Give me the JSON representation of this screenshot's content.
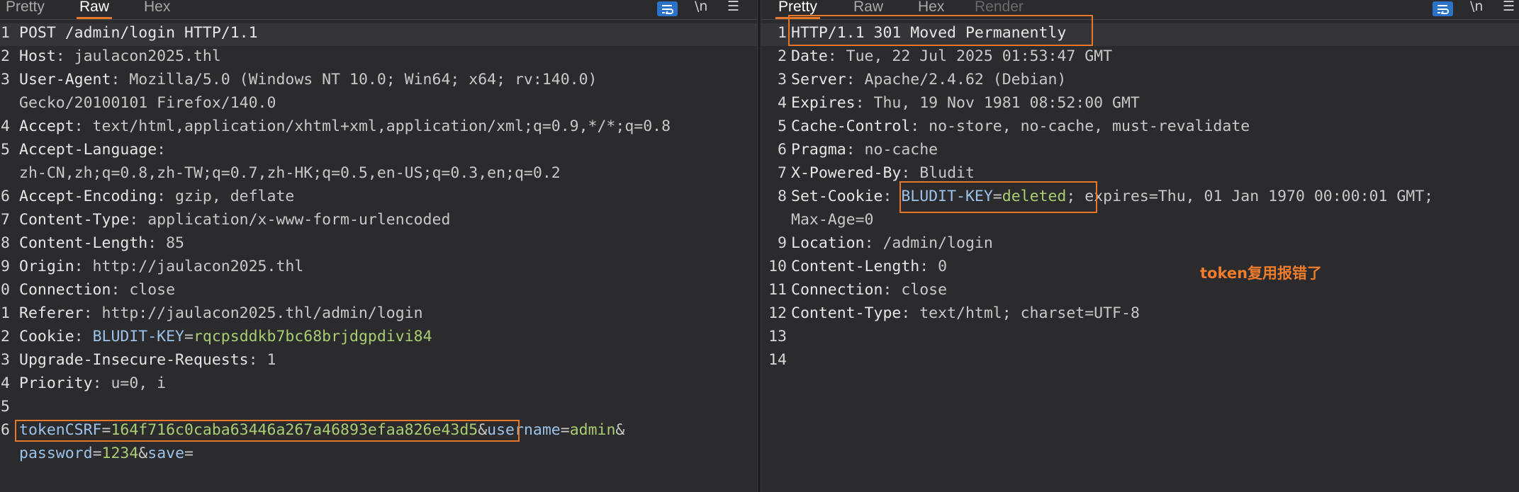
{
  "request": {
    "tabs": [
      {
        "label": "Pretty",
        "active": false
      },
      {
        "label": "Raw",
        "active": true
      },
      {
        "label": "Hex",
        "active": false
      }
    ],
    "tools": {
      "wrap_icon": "wrap-lines-icon",
      "newline_label": "\\n",
      "menu_icon": "hamburger-menu-icon"
    },
    "lines": [
      {
        "n": "1",
        "parts": [
          {
            "t": "POST /admin/login HTTP/1.1",
            "c": "k"
          }
        ]
      },
      {
        "n": "2",
        "parts": [
          {
            "t": "Host",
            "c": "k"
          },
          {
            "t": ": jaulacon2025.thl",
            "c": "v"
          }
        ]
      },
      {
        "n": "3",
        "parts": [
          {
            "t": "User-Agent",
            "c": "k"
          },
          {
            "t": ": Mozilla/5.0 (Windows NT 10.0; Win64; x64; rv:140.0)",
            "c": "v"
          }
        ]
      },
      {
        "n": "",
        "parts": [
          {
            "t": "Gecko/20100101 Firefox/140.0",
            "c": "v"
          }
        ]
      },
      {
        "n": "4",
        "parts": [
          {
            "t": "Accept",
            "c": "k"
          },
          {
            "t": ": text/html,application/xhtml+xml,application/xml;q=0.9,*/*;q=0.8",
            "c": "v"
          }
        ]
      },
      {
        "n": "5",
        "parts": [
          {
            "t": "Accept-Language",
            "c": "k"
          },
          {
            "t": ":",
            "c": "v"
          }
        ]
      },
      {
        "n": "",
        "parts": [
          {
            "t": "zh-CN,zh;q=0.8,zh-TW;q=0.7,zh-HK;q=0.5,en-US;q=0.3,en;q=0.2",
            "c": "v"
          }
        ]
      },
      {
        "n": "6",
        "parts": [
          {
            "t": "Accept-Encoding",
            "c": "k"
          },
          {
            "t": ": gzip, deflate",
            "c": "v"
          }
        ]
      },
      {
        "n": "7",
        "parts": [
          {
            "t": "Content-Type",
            "c": "k"
          },
          {
            "t": ": application/x-www-form-urlencoded",
            "c": "v"
          }
        ]
      },
      {
        "n": "8",
        "parts": [
          {
            "t": "Content-Length",
            "c": "k"
          },
          {
            "t": ": 85",
            "c": "v"
          }
        ]
      },
      {
        "n": "9",
        "parts": [
          {
            "t": "Origin",
            "c": "k"
          },
          {
            "t": ": http://jaulacon2025.thl",
            "c": "v"
          }
        ]
      },
      {
        "n": "0",
        "parts": [
          {
            "t": "Connection",
            "c": "k"
          },
          {
            "t": ": close",
            "c": "v"
          }
        ]
      },
      {
        "n": "1",
        "parts": [
          {
            "t": "Referer",
            "c": "k"
          },
          {
            "t": ": http://jaulacon2025.thl/admin/login",
            "c": "v"
          }
        ]
      },
      {
        "n": "2",
        "parts": [
          {
            "t": "Cookie",
            "c": "k"
          },
          {
            "t": ": ",
            "c": "v"
          },
          {
            "t": "BLUDIT-KEY",
            "c": "ck"
          },
          {
            "t": "=",
            "c": "v"
          },
          {
            "t": "rqcpsddkb7bc68brjdgpdivi84",
            "c": "cv"
          }
        ]
      },
      {
        "n": "3",
        "parts": [
          {
            "t": "Upgrade-Insecure-Requests",
            "c": "k"
          },
          {
            "t": ": 1",
            "c": "v"
          }
        ]
      },
      {
        "n": "4",
        "parts": [
          {
            "t": "Priority",
            "c": "k"
          },
          {
            "t": ": u=0, i",
            "c": "v"
          }
        ]
      },
      {
        "n": "5",
        "parts": []
      },
      {
        "n": "6",
        "parts": [
          {
            "t": "tokenCSRF",
            "c": "pk"
          },
          {
            "t": "=",
            "c": "v"
          },
          {
            "t": "164f716c0caba63446a267a46893efaa826e43d5",
            "c": "pv"
          },
          {
            "t": "&",
            "c": "v"
          },
          {
            "t": "username",
            "c": "pk"
          },
          {
            "t": "=",
            "c": "v"
          },
          {
            "t": "admin",
            "c": "pv"
          },
          {
            "t": "&",
            "c": "v"
          }
        ]
      },
      {
        "n": "",
        "parts": [
          {
            "t": "password",
            "c": "pk"
          },
          {
            "t": "=",
            "c": "v"
          },
          {
            "t": "1234",
            "c": "pv"
          },
          {
            "t": "&",
            "c": "v"
          },
          {
            "t": "save",
            "c": "pk"
          },
          {
            "t": "=",
            "c": "v"
          }
        ]
      }
    ]
  },
  "response": {
    "tabs": [
      {
        "label": "Pretty",
        "active": true
      },
      {
        "label": "Raw",
        "active": false
      },
      {
        "label": "Hex",
        "active": false
      },
      {
        "label": "Render",
        "active": false,
        "disabled": true
      }
    ],
    "tools": {
      "wrap_icon": "wrap-lines-icon",
      "newline_label": "\\n",
      "menu_icon": "hamburger-menu-icon"
    },
    "lines": [
      {
        "n": "1",
        "parts": [
          {
            "t": "HTTP/1.1 301 Moved Permanently",
            "c": "k"
          }
        ]
      },
      {
        "n": "2",
        "parts": [
          {
            "t": "Date",
            "c": "k"
          },
          {
            "t": ": Tue, 22 Jul 2025 01:53:47 GMT",
            "c": "v"
          }
        ]
      },
      {
        "n": "3",
        "parts": [
          {
            "t": "Server",
            "c": "k"
          },
          {
            "t": ": Apache/2.4.62 (Debian)",
            "c": "v"
          }
        ]
      },
      {
        "n": "4",
        "parts": [
          {
            "t": "Expires",
            "c": "k"
          },
          {
            "t": ": Thu, 19 Nov 1981 08:52:00 GMT",
            "c": "v"
          }
        ]
      },
      {
        "n": "5",
        "parts": [
          {
            "t": "Cache-Control",
            "c": "k"
          },
          {
            "t": ": no-store, no-cache, must-revalidate",
            "c": "v"
          }
        ]
      },
      {
        "n": "6",
        "parts": [
          {
            "t": "Pragma",
            "c": "k"
          },
          {
            "t": ": no-cache",
            "c": "v"
          }
        ]
      },
      {
        "n": "7",
        "parts": [
          {
            "t": "X-Powered-By",
            "c": "k"
          },
          {
            "t": ": Bludit",
            "c": "v"
          }
        ]
      },
      {
        "n": "8",
        "parts": [
          {
            "t": "Set-Cookie",
            "c": "k"
          },
          {
            "t": ": ",
            "c": "v"
          },
          {
            "t": "BLUDIT-KEY",
            "c": "ck"
          },
          {
            "t": "=",
            "c": "v"
          },
          {
            "t": "deleted",
            "c": "cv"
          },
          {
            "t": "; expires=Thu, 01 Jan 1970 00:00:01 GMT;",
            "c": "v"
          }
        ]
      },
      {
        "n": "",
        "parts": [
          {
            "t": "Max-Age=0",
            "c": "v"
          }
        ]
      },
      {
        "n": "9",
        "parts": [
          {
            "t": "Location",
            "c": "k"
          },
          {
            "t": ": /admin/login",
            "c": "v"
          }
        ]
      },
      {
        "n": "10",
        "parts": [
          {
            "t": "Content-Length",
            "c": "k"
          },
          {
            "t": ": 0",
            "c": "v"
          }
        ]
      },
      {
        "n": "11",
        "parts": [
          {
            "t": "Connection",
            "c": "k"
          },
          {
            "t": ": close",
            "c": "v"
          }
        ]
      },
      {
        "n": "12",
        "parts": [
          {
            "t": "Content-Type",
            "c": "k"
          },
          {
            "t": ": text/html; charset=UTF-8",
            "c": "v"
          }
        ]
      },
      {
        "n": "13",
        "parts": []
      },
      {
        "n": "14",
        "parts": []
      }
    ]
  },
  "annotation": {
    "text": "token复用报错了"
  },
  "colors": {
    "accent": "#e8772a",
    "cookie_key": "#9cc2ea",
    "cookie_value": "#a9cd72",
    "wrap_button": "#2a73c8"
  }
}
